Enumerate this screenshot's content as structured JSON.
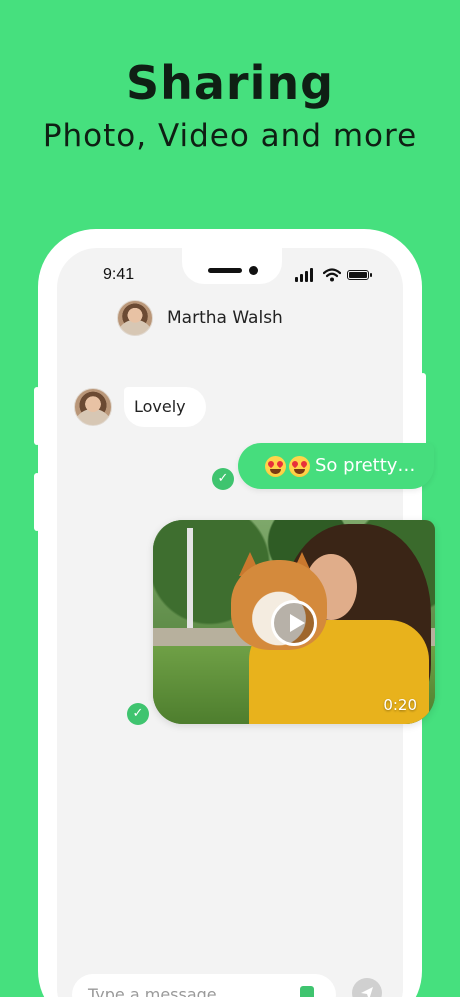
{
  "promo": {
    "headline": "Sharing",
    "subheadline": "Photo, Video and more"
  },
  "status_bar": {
    "time": "9:41",
    "icons": [
      "signal-icon",
      "wifi-icon",
      "battery-icon"
    ]
  },
  "chat": {
    "contact_name": "Martha Walsh",
    "messages": [
      {
        "direction": "incoming",
        "text": "Lovely"
      },
      {
        "direction": "outgoing",
        "text": "So pretty…",
        "emoji": [
          "heart-eyes-emoji",
          "heart-eyes-emoji"
        ],
        "status": "sent"
      },
      {
        "direction": "outgoing",
        "type": "video",
        "duration": "0:20",
        "status": "sent"
      }
    ]
  },
  "composer": {
    "placeholder": "Type a message…"
  },
  "colors": {
    "background": "#46e07e",
    "accent": "#3fc46f",
    "outgoing_bubble": "#46dd7d",
    "screen": "#f3f3f3"
  }
}
